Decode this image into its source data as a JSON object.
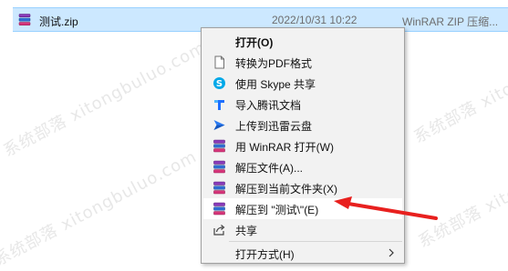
{
  "file": {
    "name": "测试.zip",
    "date": "2022/10/31 10:22",
    "type": "WinRAR ZIP 压缩..."
  },
  "menu": {
    "items": [
      {
        "label": "打开(O)",
        "icon": "none-icon"
      },
      {
        "label": "转换为PDF格式",
        "icon": "pdf-doc-icon"
      },
      {
        "label": "使用 Skype 共享",
        "icon": "skype-icon"
      },
      {
        "label": "导入腾讯文档",
        "icon": "tencent-docs-icon"
      },
      {
        "label": "上传到迅雷云盘",
        "icon": "xunlei-icon"
      },
      {
        "label": "用 WinRAR 打开(W)",
        "icon": "winrar-icon"
      },
      {
        "label": "解压文件(A)...",
        "icon": "winrar-icon"
      },
      {
        "label": "解压到当前文件夹(X)",
        "icon": "winrar-icon"
      },
      {
        "label": "解压到 \"测试\\\"(E)",
        "icon": "winrar-icon"
      },
      {
        "label": "共享",
        "icon": "share-icon"
      },
      {
        "label": "打开方式(H)",
        "icon": "none-icon"
      }
    ],
    "highlighted_index": 8
  },
  "watermark": {
    "text": "系统部落 xitongbuluo.com"
  },
  "colors": {
    "selection_bg": "#cce8ff",
    "menu_bg": "#f2f2f2",
    "arrow": "#e8201e"
  }
}
